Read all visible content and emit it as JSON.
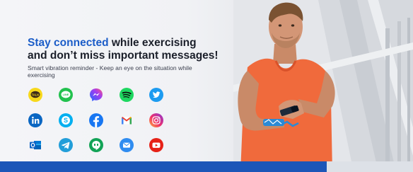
{
  "headline": {
    "accent": "Stay connected",
    "rest": " while exercising",
    "line2": "and don’t miss important messages!"
  },
  "subtext": "Smart vibration reminder - Keep an eye on the situation while exercising",
  "colors": {
    "accent": "#1c5dc8",
    "text": "#1b1f2a",
    "bottom_bar": "#1c56b8"
  },
  "icons": [
    [
      "kakaotalk-icon",
      "line-icon",
      "messenger-icon",
      "spotify-icon",
      "twitter-icon"
    ],
    [
      "linkedin-icon",
      "skype-icon",
      "facebook-icon",
      "gmail-icon",
      "instagram-icon"
    ],
    [
      "outlook-icon",
      "telegram-icon",
      "hangouts-icon",
      "mail-icon",
      "youtube-icon"
    ]
  ]
}
